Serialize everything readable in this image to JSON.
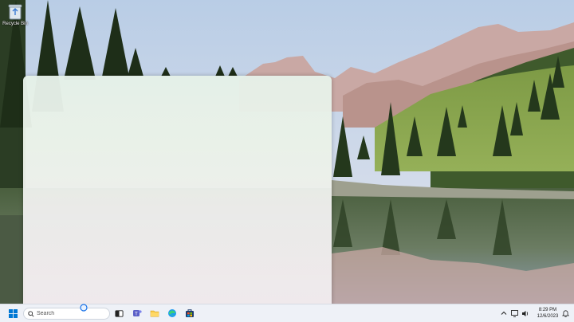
{
  "desktop": {
    "icons": [
      {
        "label": "Recycle Bin",
        "icon": "recycle-bin-icon"
      }
    ]
  },
  "taskbar": {
    "search": {
      "placeholder": "Search"
    },
    "pinned": [
      {
        "name": "start",
        "icon": "windows-logo-icon"
      },
      {
        "name": "task-view",
        "icon": "task-view-icon"
      },
      {
        "name": "teams",
        "icon": "teams-icon"
      },
      {
        "name": "file-explorer",
        "icon": "folder-icon"
      },
      {
        "name": "edge",
        "icon": "edge-icon"
      },
      {
        "name": "microsoft-store",
        "icon": "store-icon"
      }
    ],
    "tray": {
      "overflow_icon": "chevron-up-icon",
      "network_icon": "network-icon",
      "volume_icon": "volume-icon",
      "notification_icon": "bell-icon"
    },
    "clock": {
      "time": "8:29 PM",
      "date": "12/6/2023"
    }
  },
  "colors": {
    "taskbar_bg": "#eef1f7",
    "accent": "#0067c0",
    "panel_top": "#e6f1e9",
    "panel_bottom": "#f3ecef"
  }
}
